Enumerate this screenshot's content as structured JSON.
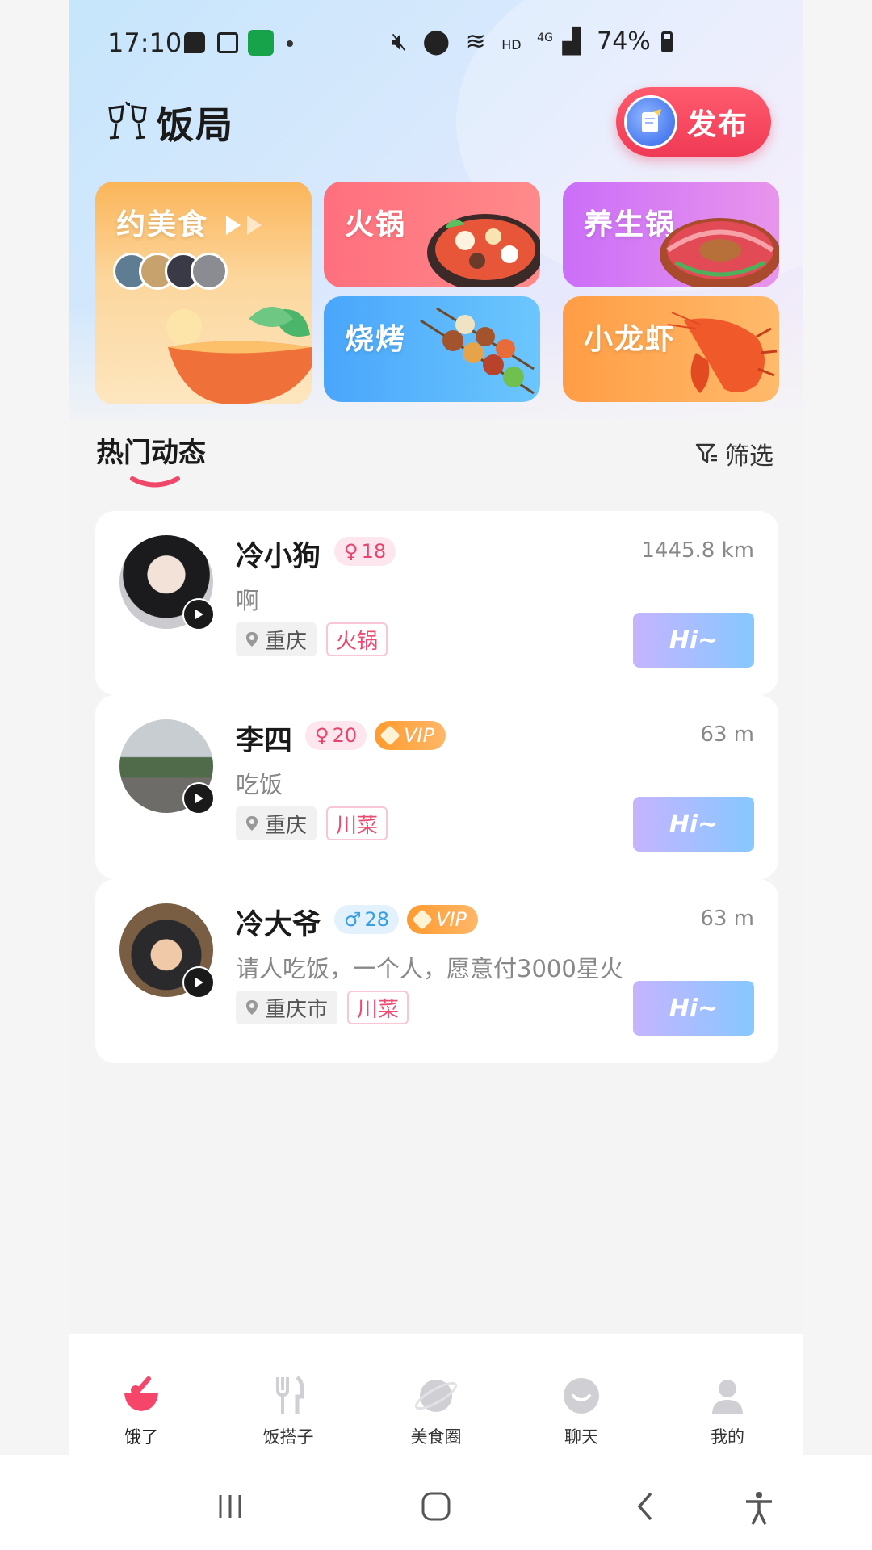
{
  "status_bar": {
    "time": "17:10",
    "right_text": "HD",
    "network": "4G",
    "battery": "74%"
  },
  "header": {
    "app_title": "饭局",
    "publish_label": "发布"
  },
  "categories": {
    "main": {
      "label": "约美食"
    },
    "hotpot": {
      "label": "火锅"
    },
    "yangsheng": {
      "label": "养生锅"
    },
    "bbq": {
      "label": "烧烤"
    },
    "crayfish": {
      "label": "小龙虾"
    }
  },
  "section": {
    "title": "热门动态",
    "filter_label": "筛选"
  },
  "feed": [
    {
      "name": "冷小狗",
      "gender": "female",
      "age": "18",
      "vip": false,
      "distance": "1445.8 km",
      "desc": "啊",
      "location": "重庆",
      "food_tag": "火锅",
      "hi_label": "Hi~"
    },
    {
      "name": "李四",
      "gender": "female",
      "age": "20",
      "vip": true,
      "vip_label": "VIP",
      "distance": "63 m",
      "desc": "吃饭",
      "location": "重庆",
      "food_tag": "川菜",
      "hi_label": "Hi~"
    },
    {
      "name": "冷大爷",
      "gender": "male",
      "age": "28",
      "vip": true,
      "vip_label": "VIP",
      "distance": "63 m",
      "desc": "请人吃饭，一个人，愿意付3000星火",
      "location": "重庆市",
      "food_tag": "川菜",
      "hi_label": "Hi~"
    }
  ],
  "tabbar": {
    "tabs": [
      {
        "label": "饿了",
        "active": true
      },
      {
        "label": "饭搭子",
        "active": false
      },
      {
        "label": "美食圈",
        "active": false
      },
      {
        "label": "聊天",
        "active": false
      },
      {
        "label": "我的",
        "active": false
      }
    ]
  },
  "colors": {
    "accent": "#f03a55",
    "tag_pink": "#ee4a71",
    "tab_active": "#f5466a",
    "tab_inactive": "#cfcfd4"
  }
}
